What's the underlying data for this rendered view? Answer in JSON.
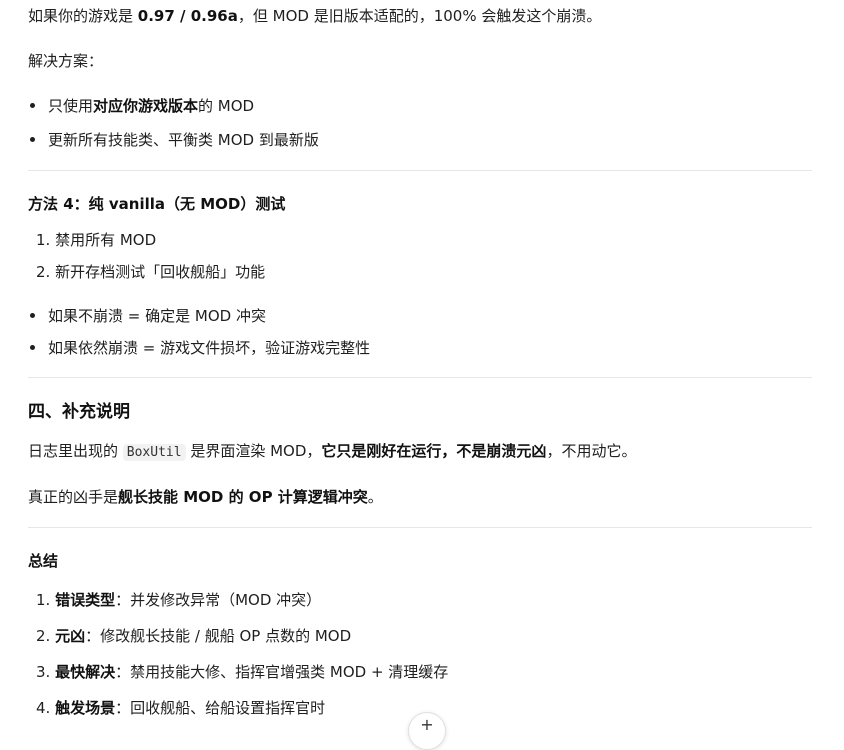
{
  "p1": {
    "a": "如果你的游戏是 ",
    "b": "0.97 / 0.96a",
    "c": "，但 MOD 是旧版本适配的，100% 会触发这个崩溃。"
  },
  "solution_label": "解决方案：",
  "solution_bullets": [
    {
      "pre": "只使用",
      "bold": "对应你游戏版本",
      "post": "的 MOD"
    },
    {
      "text": "更新所有技能类、平衡类 MOD 到最新版"
    }
  ],
  "method4": {
    "title": "方法 4：纯 vanilla（无 MOD）测试",
    "steps": [
      "1. 禁用所有 MOD",
      "2. 新开存档测试「回收舰船」功能"
    ],
    "results": [
      "如果不崩溃 = 确定是 MOD 冲突",
      "如果依然崩溃 = 游戏文件损坏，验证游戏完整性"
    ]
  },
  "section4": {
    "title": "四、补充说明",
    "p1_a": "日志里出现的 ",
    "p1_code": "BoxUtil",
    "p1_b": " 是界面渲染 MOD，",
    "p1_bold": "它只是刚好在运行，不是崩溃元凶",
    "p1_c": "，不用动它。",
    "p2_a": "真正的凶手是",
    "p2_bold": "舰长技能 MOD 的 OP 计算逻辑冲突",
    "p2_c": "。"
  },
  "summary": {
    "title": "总结",
    "items": [
      {
        "num": "1. ",
        "label": "错误类型",
        "text": "：并发修改异常（MOD 冲突）"
      },
      {
        "num": "2. ",
        "label": "元凶",
        "text": "：修改舰长技能 / 舰船 OP 点数的 MOD"
      },
      {
        "num": "3. ",
        "label": "最快解决",
        "text": "：禁用技能大修、指挥官增强类 MOD + 清理缓存"
      },
      {
        "num": "4. ",
        "label": "触发场景",
        "text": "：回收舰船、给船设置指挥官时"
      }
    ]
  },
  "fab_icon": "plus-icon",
  "fab_glyph": "+"
}
